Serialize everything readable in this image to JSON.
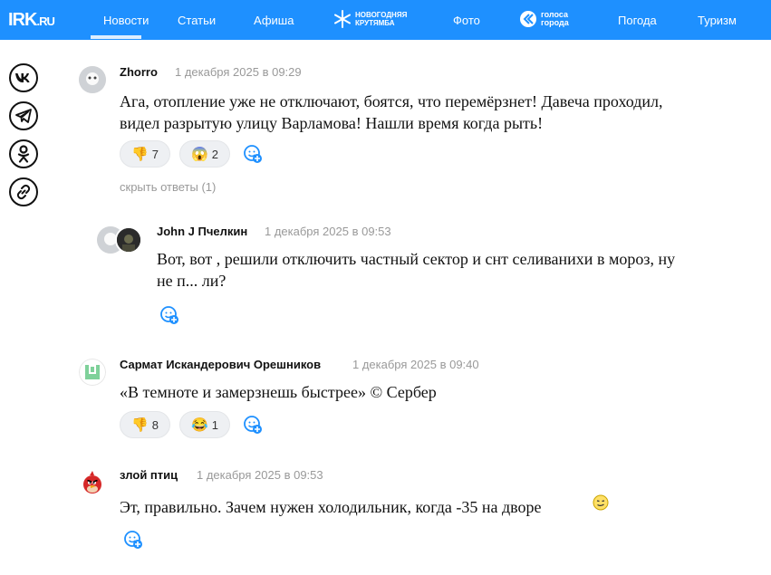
{
  "header": {
    "logo_main": "IRK",
    "logo_suffix": ".RU",
    "nav": [
      {
        "label": "Новости"
      },
      {
        "label": "Статьи"
      },
      {
        "label": "Афиша"
      },
      {
        "label": "Фото"
      },
      {
        "label": "Погода"
      },
      {
        "label": "Туризм"
      }
    ],
    "promo1": {
      "line1": "НОВОГОДНЯЯ",
      "line2": "КРУТЯМБА"
    },
    "promo2": {
      "line1": "голоса",
      "line2": "города"
    }
  },
  "share_icons": [
    "vk-icon",
    "telegram-icon",
    "odnoklassniki-icon",
    "link-icon"
  ],
  "comments": [
    {
      "author": "Zhorro",
      "date": "1 декабря 2025 в 09:29",
      "line1": "Ага, отопление уже не отключают, боятся, что перемёрзнет! Давеча проходил,",
      "line2": "видел разрытую улицу Варламова! Нашли время когда рыть!",
      "reactions": [
        {
          "emoji": "👎",
          "count": "7"
        },
        {
          "emoji": "😱",
          "count": "2"
        }
      ],
      "hide_replies": "скрыть ответы (1)"
    },
    {
      "author": "John J Пчелкин",
      "date": "1 декабря 2025 в 09:53",
      "line1": "Вот, вот , решили отключить частный сектор и снт селиванихи в мороз, ну",
      "line2": "не п... ли?"
    },
    {
      "author": "Сармат Искандерович Орешников",
      "date": "1 декабря 2025 в 09:40",
      "line1": "«В темноте и замерзнешь быстрее» © Сербер",
      "reactions": [
        {
          "emoji": "👎",
          "count": "8"
        },
        {
          "emoji": "😂",
          "count": "1"
        }
      ]
    },
    {
      "author": "злой птиц",
      "date": "1 декабря 2025 в 09:53",
      "line1": "Эт, правильно. Зачем нужен холодильник, когда -35 на дворе"
    }
  ]
}
